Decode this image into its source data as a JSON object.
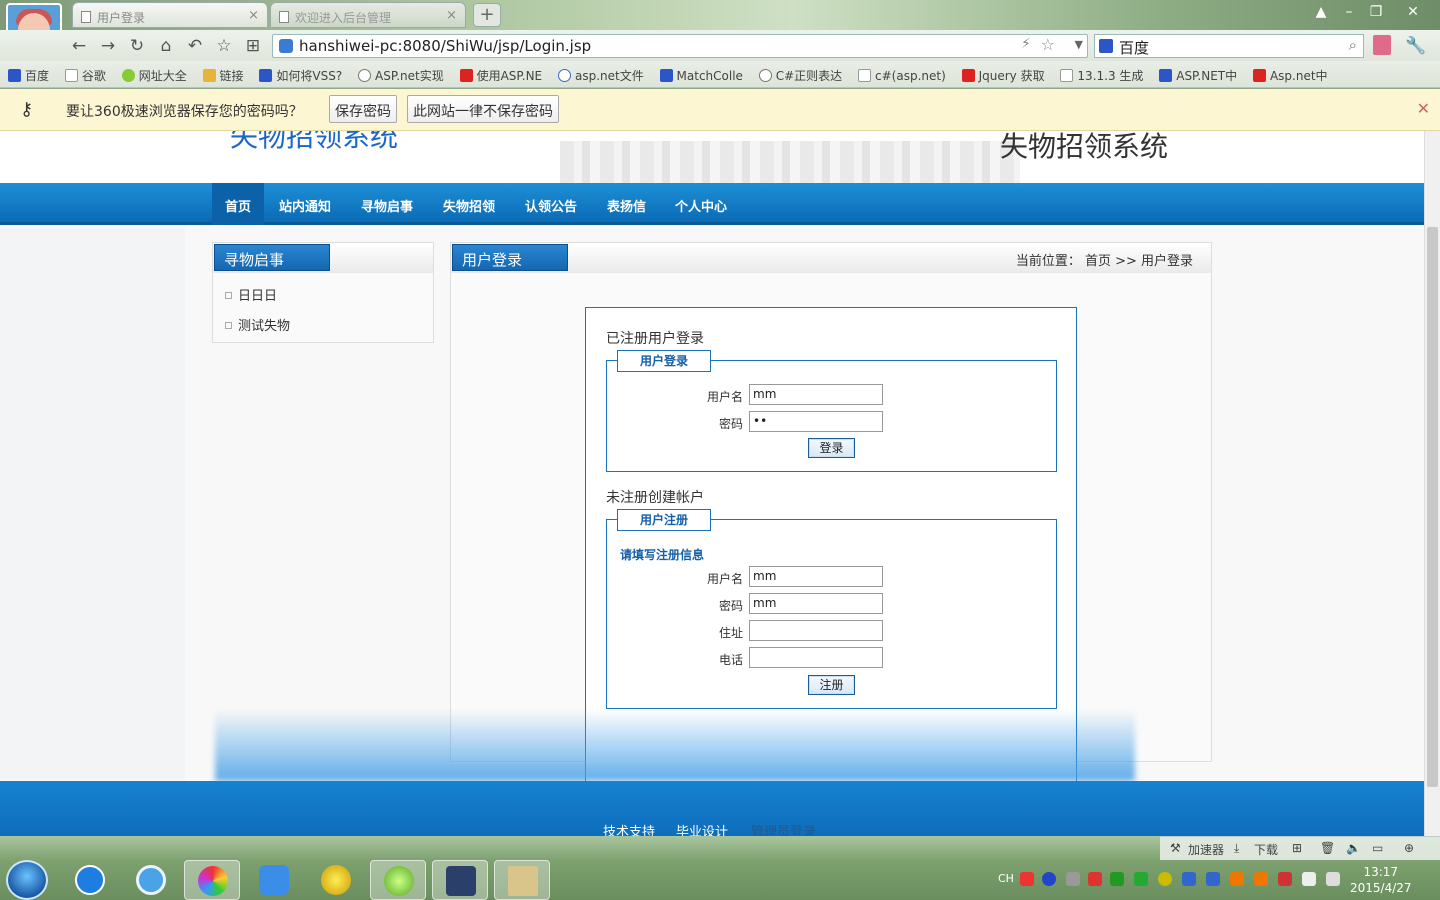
{
  "browser": {
    "tabs": [
      {
        "title": "用户登录"
      },
      {
        "title": "欢迎进入后台管理"
      }
    ],
    "new_tab": "+",
    "url": "hanshiwei-pc:8080/ShiWu/jsp/Login.jsp",
    "search_engine": "百度",
    "bookmarks": [
      "百度",
      "谷歌",
      "网址大全",
      "链接",
      "如何将VSS?",
      "ASP.net实现",
      "使用ASP.NE",
      "asp.net文件",
      "MatchColle",
      "C#正则表达",
      "c#(asp.net)",
      "Jquery 获取",
      "13.1.3 生成",
      "ASP.NET中",
      "Asp.net中"
    ],
    "infobar": {
      "message": "要让360极速浏览器保存您的密码吗？",
      "save_button": "保存密码",
      "never_button": "此网站一律不保存密码"
    }
  },
  "site": {
    "title_left": "失物招领系统",
    "title_right": "失物招领系统",
    "nav": [
      "首页",
      "站内通知",
      "寻物启事",
      "失物招领",
      "认领公告",
      "表扬信",
      "个人中心"
    ],
    "sidebar": {
      "heading": "寻物启事",
      "items": [
        "日日日",
        "测试失物"
      ]
    },
    "main": {
      "heading": "用户登录",
      "breadcrumb": "当前位置： 首页 >>  用户登录",
      "login_section_title": "已注册用户登录",
      "login_legend": "用户登录",
      "login_username_label": "用户名",
      "login_username_value": "mm",
      "login_password_label": "密码",
      "login_password_value": "••",
      "login_button": "登录",
      "register_section_title": "未注册创建帐户",
      "register_legend": "用户注册",
      "register_hint": "请填写注册信息",
      "reg_username_label": "用户名",
      "reg_username_value": "mm",
      "reg_password_label": "密码",
      "reg_password_value": "mm",
      "reg_address_label": "住址",
      "reg_address_value": "",
      "reg_phone_label": "电话",
      "reg_phone_value": "",
      "register_button": "注册"
    },
    "footer": [
      "技术支持",
      "毕业设计",
      "管理员登录"
    ]
  },
  "taskbar": {
    "quickbar": [
      "加速器",
      "下载"
    ],
    "input_lang": "CH",
    "time": "13:17",
    "date": "2015/4/27"
  }
}
